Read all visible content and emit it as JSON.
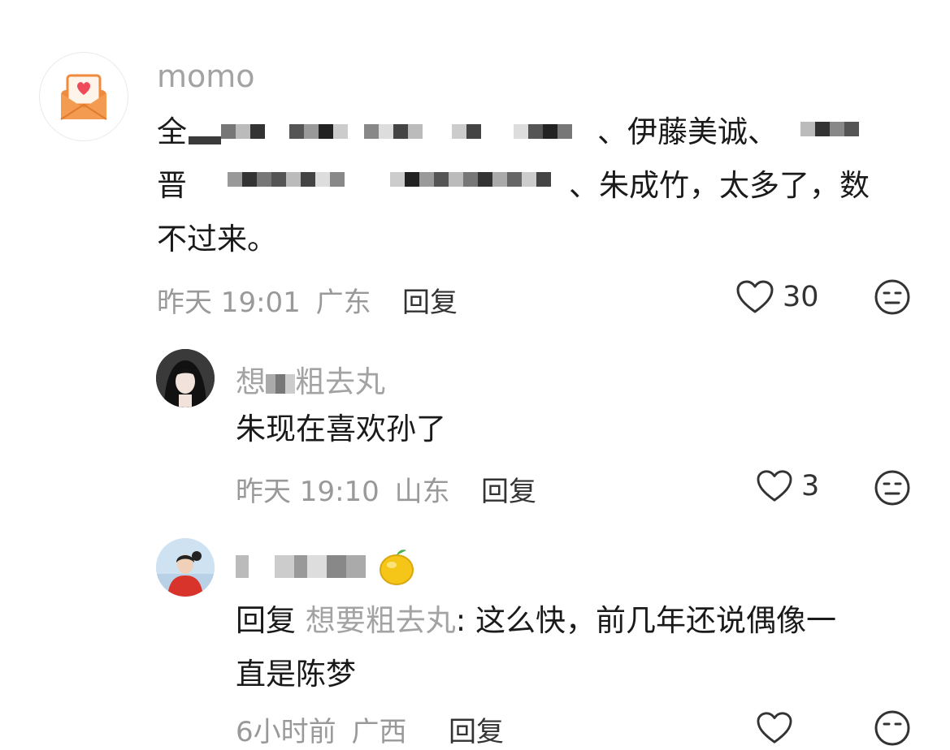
{
  "comments": [
    {
      "username": "momo",
      "text_line1_visible_a": "全",
      "text_line1_visible_b": "、伊藤美诚、",
      "text_line2_visible_a": "晋",
      "text_line2_visible_b": "、朱成竹，太多了，数",
      "text_line3": "不过来。",
      "time": "昨天 19:01",
      "location": "广东",
      "reply_label": "回复",
      "likes": "30"
    },
    {
      "username_a": "想",
      "username_b": "粗去丸",
      "text": "朱现在喜欢孙了",
      "time": "昨天 19:10",
      "location": "山东",
      "reply_label": "回复",
      "likes": "3"
    },
    {
      "reply_prefix": "回复",
      "reply_to": "想要粗去丸",
      "text_line1": ": 这么快，前几年还说偶像一",
      "text_line2": "直是陈梦",
      "time": "6小时前",
      "location": "广西",
      "reply_label": "回复"
    }
  ],
  "colors": {
    "text": "#1a1a1a",
    "muted": "#999999",
    "name": "#a3a3a3",
    "avatar_orange": "#f08a3c",
    "heart_red": "#ee4a5a"
  },
  "icons": [
    "heart-outline-icon",
    "meh-face-icon",
    "envelope-heart-avatar",
    "lemon-emoji"
  ]
}
